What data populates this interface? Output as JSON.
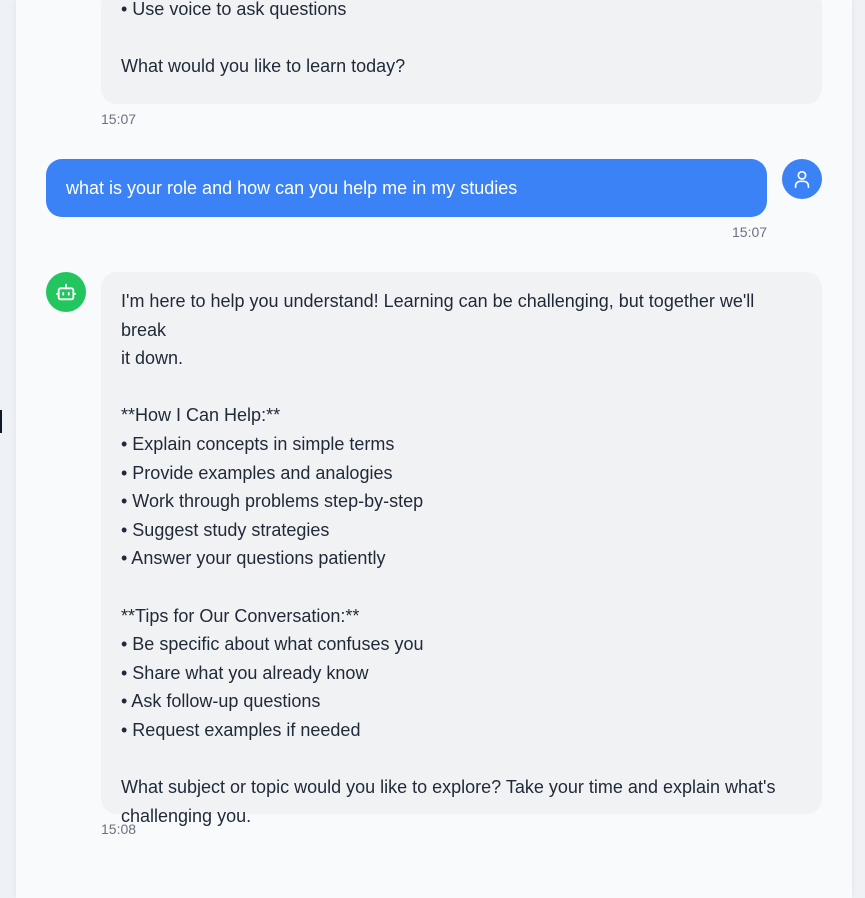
{
  "colors": {
    "user_bubble": "#3b82f6",
    "bot_bubble": "#f1f2f4",
    "user_avatar": "#3b82f6",
    "bot_avatar": "#22c55e"
  },
  "messages": [
    {
      "role": "assistant",
      "lines": [
        "• Use voice to ask questions",
        "",
        "What would you like to learn today?"
      ],
      "time": "15:07"
    },
    {
      "role": "user",
      "avatar_icon": "user-icon",
      "text": "what is your role and how can you help me in my studies",
      "time": "15:07"
    },
    {
      "role": "assistant",
      "avatar_icon": "robot-icon",
      "lines": [
        "I'm here to help you understand! Learning can be challenging, but together we'll break",
        "it down.",
        "",
        "**How I Can Help:**",
        "• Explain concepts in simple terms",
        "• Provide examples and analogies",
        "• Work through problems step-by-step",
        "• Suggest study strategies",
        "• Answer your questions patiently",
        "",
        "**Tips for Our Conversation:**",
        "• Be specific about what confuses you",
        "• Share what you already know",
        "• Ask follow-up questions",
        "• Request examples if needed",
        "",
        "What subject or topic would you like to explore? Take your time and explain what's",
        "challenging you."
      ],
      "time": "15:08"
    }
  ]
}
